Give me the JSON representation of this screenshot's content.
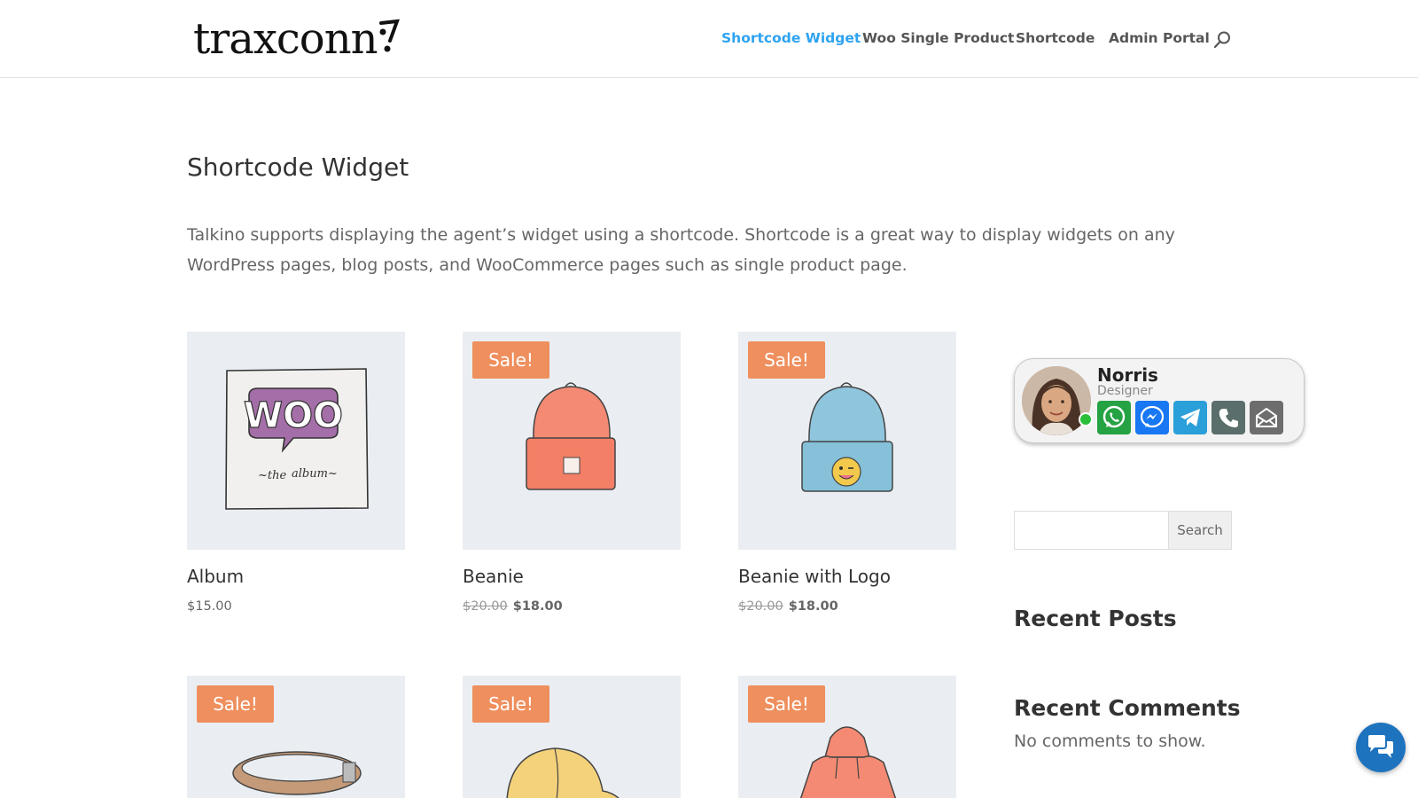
{
  "header": {
    "logo_text": "traxconn",
    "nav": [
      {
        "label": "Shortcode Widget",
        "active": true
      },
      {
        "label": "Woo Single Product",
        "active": false
      },
      {
        "label": "Shortcode",
        "active": false
      },
      {
        "label": "Admin Portal",
        "active": false
      }
    ],
    "search_icon": "search-icon",
    "active_color": "#2ea3f2"
  },
  "page": {
    "title": "Shortcode Widget",
    "intro": "Talkino supports displaying the agent’s widget using a shortcode. Shortcode is a great way to display widgets on any WordPress pages, blog posts, and WooCommerce pages such as single product page."
  },
  "products": [
    {
      "name": "Album",
      "price": "$15.00",
      "old_price": "",
      "sale": false,
      "badge": ""
    },
    {
      "name": "Beanie",
      "price": "$18.00",
      "old_price": "$20.00",
      "sale": true,
      "badge": "Sale!"
    },
    {
      "name": "Beanie with Logo",
      "price": "$18.00",
      "old_price": "$20.00",
      "sale": true,
      "badge": "Sale!"
    },
    {
      "name": "",
      "price": "",
      "old_price": "",
      "sale": true,
      "badge": "Sale!"
    },
    {
      "name": "",
      "price": "",
      "old_price": "",
      "sale": true,
      "badge": "Sale!"
    },
    {
      "name": "",
      "price": "",
      "old_price": "",
      "sale": true,
      "badge": "Sale!"
    }
  ],
  "agent": {
    "name": "Norris",
    "role": "Designer",
    "status": "online",
    "channels": [
      {
        "icon": "whatsapp-icon",
        "color": "#25a244"
      },
      {
        "icon": "messenger-icon",
        "color": "#1877f2"
      },
      {
        "icon": "telegram-icon",
        "color": "#2a9fd9"
      },
      {
        "icon": "phone-icon",
        "color": "#5a6e6b"
      },
      {
        "icon": "email-icon",
        "color": "#6d6d6d"
      }
    ]
  },
  "sidebar": {
    "search_button": "Search",
    "search_placeholder": "",
    "recent_posts_title": "Recent Posts",
    "recent_comments_title": "Recent Comments",
    "no_comments": "No comments to show."
  },
  "colors": {
    "sale_badge": "#ef8f5e",
    "chat_fab": "#1e73be"
  }
}
